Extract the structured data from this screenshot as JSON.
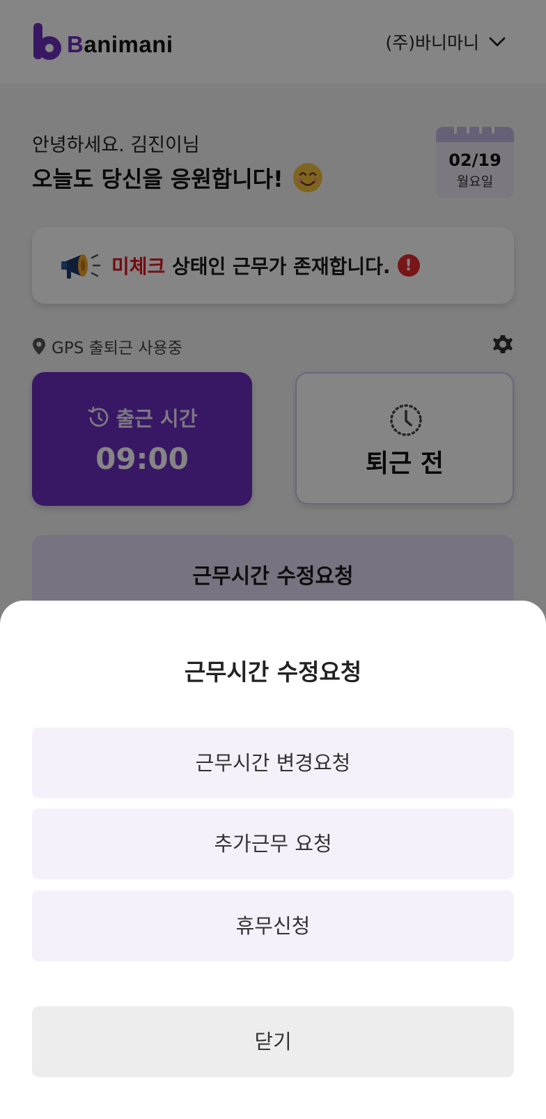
{
  "header": {
    "logo_b": "B",
    "logo_rest": "animani",
    "company": "(주)바니마니"
  },
  "greeting": {
    "line1": "안녕하세요. 김진이님",
    "line2": "오늘도 당신을 응원합니다!"
  },
  "calendar": {
    "date": "02/19",
    "weekday": "월요일"
  },
  "notice": {
    "highlight": "미체크",
    "text": " 상태인 근무가 존재합니다.",
    "alert_mark": "!"
  },
  "gps": {
    "label": "GPS 출퇴근 사용중"
  },
  "clock_in": {
    "label": "출근 시간",
    "time": "09:00"
  },
  "clock_out": {
    "status": "퇴근 전"
  },
  "modify_button": {
    "label": "근무시간 수정요청"
  },
  "sheet": {
    "title": "근무시간 수정요청",
    "options": [
      {
        "label": "근무시간 변경요청"
      },
      {
        "label": "추가근무 요청"
      },
      {
        "label": "휴무신청"
      }
    ],
    "close_label": "닫기"
  },
  "colors": {
    "brand_purple": "#6c2fc0",
    "alert_red": "#e5292d",
    "option_bg": "#f4f1fb"
  },
  "icons": [
    "logo-icon",
    "chevron-down-icon",
    "smile-emoji-icon",
    "calendar-icon",
    "megaphone-icon",
    "alert-icon",
    "location-pin-icon",
    "gear-icon",
    "history-icon",
    "clock-icon"
  ]
}
